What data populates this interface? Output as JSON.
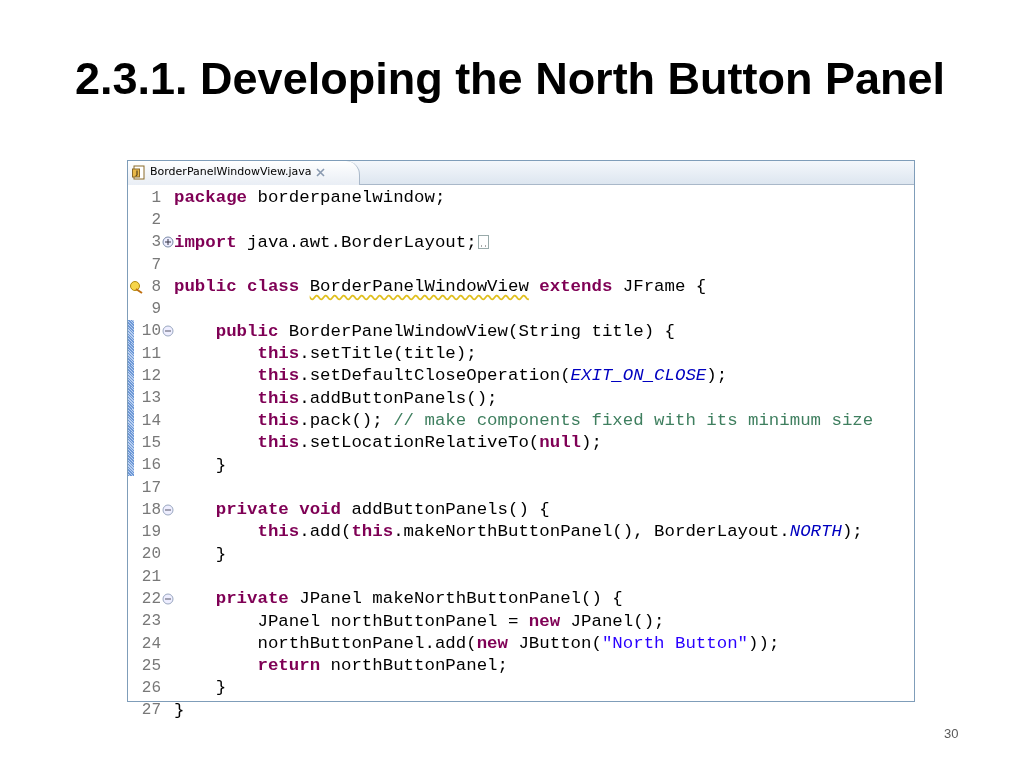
{
  "slide_title": "2.3.1. Developing the North Button Panel",
  "editor": {
    "tab": {
      "label": "BorderPanelWindowView.java",
      "selected": true
    },
    "lines": [
      {
        "number": "1",
        "changed": false,
        "kind": "line",
        "tokens": [
          {
            "kind": "keyword",
            "text": "package "
          },
          {
            "kind": "plain",
            "text": "borderpanelwindow;"
          }
        ]
      },
      {
        "number": "2",
        "changed": false,
        "kind": "line"
      },
      {
        "number": "3",
        "changed": false,
        "kind": "fold-closed",
        "tokens": [
          {
            "kind": "keyword",
            "text": "import "
          },
          {
            "kind": "plain",
            "text": "java.awt.BorderLayout;"
          }
        ]
      },
      {
        "number": "7",
        "changed": false,
        "kind": "line"
      },
      {
        "number": "8",
        "changed": false,
        "kind": "warning",
        "tokens": [
          {
            "kind": "keyword",
            "text": "public class "
          },
          {
            "kind": "warned",
            "text": "BorderPanelWindowView"
          },
          {
            "kind": "keyword",
            "text": " extends "
          },
          {
            "kind": "plain",
            "text": "JFrame {"
          }
        ]
      },
      {
        "number": "9",
        "changed": false,
        "kind": "line"
      },
      {
        "number": "10",
        "changed": true,
        "kind": "fold-open",
        "tokens": [
          {
            "kind": "keyword",
            "text": "    public "
          },
          {
            "kind": "plain",
            "text": "BorderPanelWindowView(String title) {"
          }
        ]
      },
      {
        "number": "11",
        "changed": true,
        "kind": "line",
        "tokens": [
          {
            "kind": "keyword",
            "text": "        this"
          },
          {
            "kind": "plain",
            "text": ".setTitle(title);"
          }
        ]
      },
      {
        "number": "12",
        "changed": true,
        "kind": "line",
        "tokens": [
          {
            "kind": "keyword",
            "text": "        this"
          },
          {
            "kind": "plain",
            "text": ".setDefaultCloseOperation("
          },
          {
            "kind": "constant",
            "text": "EXIT_ON_CLOSE"
          },
          {
            "kind": "plain",
            "text": ");"
          }
        ]
      },
      {
        "number": "13",
        "changed": true,
        "kind": "line",
        "tokens": [
          {
            "kind": "keyword",
            "text": "        this"
          },
          {
            "kind": "plain",
            "text": ".addButtonPanels();"
          }
        ]
      },
      {
        "number": "14",
        "changed": true,
        "kind": "line",
        "tokens": [
          {
            "kind": "keyword",
            "text": "        this"
          },
          {
            "kind": "plain",
            "text": ".pack(); "
          },
          {
            "kind": "comment",
            "text": "// make components fixed with its minimum size"
          }
        ]
      },
      {
        "number": "15",
        "changed": true,
        "kind": "line",
        "tokens": [
          {
            "kind": "keyword",
            "text": "        this"
          },
          {
            "kind": "plain",
            "text": ".setLocationRelativeTo("
          },
          {
            "kind": "keyword",
            "text": "null"
          },
          {
            "kind": "plain",
            "text": ");"
          }
        ]
      },
      {
        "number": "16",
        "changed": true,
        "kind": "line",
        "tokens": [
          {
            "kind": "plain",
            "text": "    }"
          }
        ]
      },
      {
        "number": "17",
        "changed": false,
        "kind": "line"
      },
      {
        "number": "18",
        "changed": false,
        "kind": "fold-open",
        "tokens": [
          {
            "kind": "keyword",
            "text": "    private void "
          },
          {
            "kind": "plain",
            "text": "addButtonPanels() {"
          }
        ]
      },
      {
        "number": "19",
        "changed": false,
        "kind": "line",
        "tokens": [
          {
            "kind": "keyword",
            "text": "        this"
          },
          {
            "kind": "plain",
            "text": ".add("
          },
          {
            "kind": "keyword",
            "text": "this"
          },
          {
            "kind": "plain",
            "text": ".makeNorthButtonPanel(), BorderLayout."
          },
          {
            "kind": "constant",
            "text": "NORTH"
          },
          {
            "kind": "plain",
            "text": ");"
          }
        ]
      },
      {
        "number": "20",
        "changed": false,
        "kind": "line",
        "tokens": [
          {
            "kind": "plain",
            "text": "    }"
          }
        ]
      },
      {
        "number": "21",
        "changed": false,
        "kind": "line"
      },
      {
        "number": "22",
        "changed": false,
        "kind": "fold-open",
        "tokens": [
          {
            "kind": "keyword",
            "text": "    private "
          },
          {
            "kind": "plain",
            "text": "JPanel makeNorthButtonPanel() {"
          }
        ]
      },
      {
        "number": "23",
        "changed": false,
        "kind": "line",
        "tokens": [
          {
            "kind": "plain",
            "text": "        JPanel northButtonPanel = "
          },
          {
            "kind": "keyword",
            "text": "new "
          },
          {
            "kind": "plain",
            "text": "JPanel();"
          }
        ]
      },
      {
        "number": "24",
        "changed": false,
        "kind": "line",
        "tokens": [
          {
            "kind": "plain",
            "text": "        northButtonPanel.add("
          },
          {
            "kind": "keyword",
            "text": "new "
          },
          {
            "kind": "plain",
            "text": "JButton("
          },
          {
            "kind": "string",
            "text": "\"North Button\""
          },
          {
            "kind": "plain",
            "text": "));"
          }
        ]
      },
      {
        "number": "25",
        "changed": false,
        "kind": "line",
        "tokens": [
          {
            "kind": "keyword",
            "text": "        return "
          },
          {
            "kind": "plain",
            "text": "northButtonPanel;"
          }
        ]
      },
      {
        "number": "26",
        "changed": false,
        "kind": "line",
        "tokens": [
          {
            "kind": "plain",
            "text": "    }"
          }
        ]
      },
      {
        "number": "27",
        "changed": false,
        "kind": "line",
        "tokens": [
          {
            "kind": "plain",
            "text": "}"
          }
        ]
      }
    ]
  },
  "page_number": "30"
}
